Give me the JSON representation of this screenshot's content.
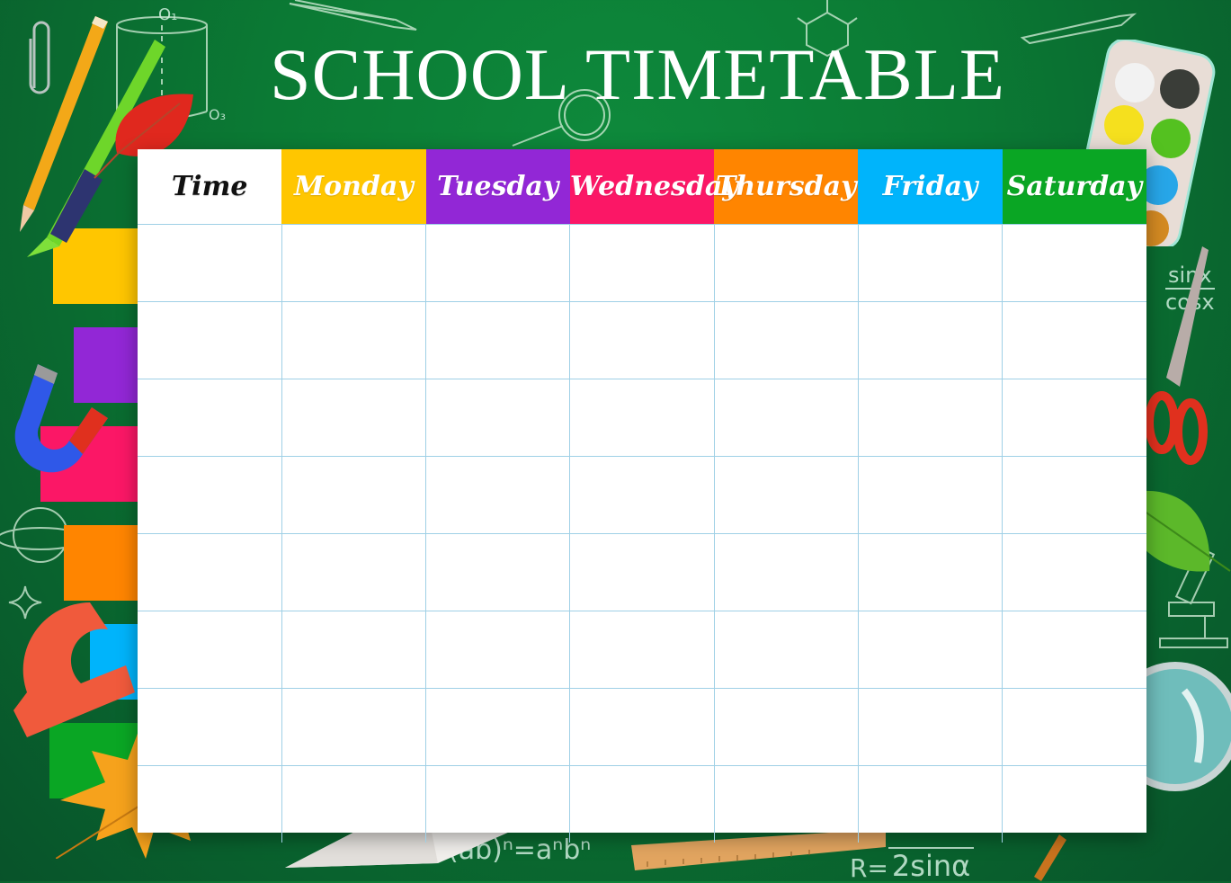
{
  "header": {
    "title": "SCHOOL TIMETABLE"
  },
  "timetable": {
    "columns": [
      {
        "label": "Time",
        "color": "#ffffff"
      },
      {
        "label": "Monday",
        "color": "#ffc600"
      },
      {
        "label": "Tuesday",
        "color": "#9227d6"
      },
      {
        "label": "Wednesday",
        "color": "#fb1766"
      },
      {
        "label": "Thursday",
        "color": "#ff8500"
      },
      {
        "label": "Friday",
        "color": "#00b4fb"
      },
      {
        "label": "Saturday",
        "color": "#0aa624"
      }
    ],
    "row_count": 8,
    "rows": [
      [
        "",
        "",
        "",
        "",
        "",
        "",
        ""
      ],
      [
        "",
        "",
        "",
        "",
        "",
        "",
        ""
      ],
      [
        "",
        "",
        "",
        "",
        "",
        "",
        ""
      ],
      [
        "",
        "",
        "",
        "",
        "",
        "",
        ""
      ],
      [
        "",
        "",
        "",
        "",
        "",
        "",
        ""
      ],
      [
        "",
        "",
        "",
        "",
        "",
        "",
        ""
      ],
      [
        "",
        "",
        "",
        "",
        "",
        "",
        ""
      ],
      [
        "",
        "",
        "",
        "",
        "",
        "",
        ""
      ]
    ]
  },
  "side_tabs": [
    {
      "color": "#ffc600"
    },
    {
      "color": "#9227d6"
    },
    {
      "color": "#fb1766"
    },
    {
      "color": "#ff8500"
    },
    {
      "color": "#00b4fb"
    },
    {
      "color": "#0aa624"
    }
  ],
  "chalk_formulas": {
    "formula_1": "(ab)ⁿ=aⁿbⁿ",
    "formula_2": "R=",
    "formula_2_den": "2sinα",
    "formula_3_num": "sinx",
    "formula_3_den": "cosx",
    "label_o1": "O₁",
    "label_o3": "O₃"
  },
  "decorations": [
    "pencil-icon",
    "pen-icon",
    "paperclip-icon",
    "red-leaf-icon",
    "magnet-icon",
    "protractor-icon",
    "maple-leaf-icon",
    "paper-plane-icon",
    "ruler-icon",
    "watercolor-palette-icon",
    "scissors-icon",
    "green-leaf-icon",
    "magnifier-icon"
  ]
}
